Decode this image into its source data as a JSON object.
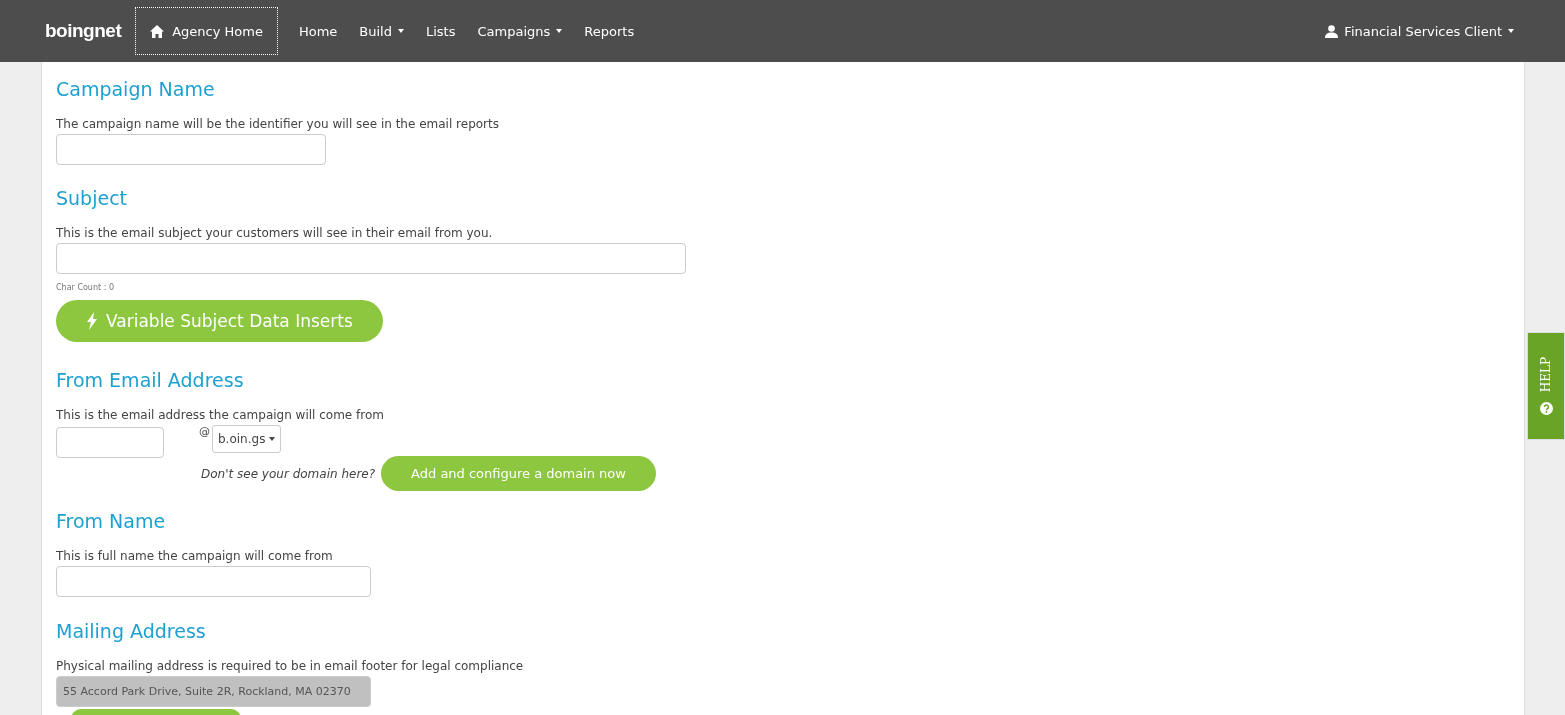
{
  "nav": {
    "logo": "boingnet",
    "agency_home": "Agency Home",
    "items": [
      {
        "label": "Home",
        "dropdown": false
      },
      {
        "label": "Build",
        "dropdown": true
      },
      {
        "label": "Lists",
        "dropdown": false
      },
      {
        "label": "Campaigns",
        "dropdown": true
      },
      {
        "label": "Reports",
        "dropdown": false
      }
    ],
    "user": "Financial Services Client"
  },
  "campaign_name": {
    "heading": "Campaign Name",
    "description": "The campaign name will be the identifier you will see in the email reports"
  },
  "subject": {
    "heading": "Subject",
    "description": "This is the email subject your customers will see in their email from you.",
    "char_count": "Char Count : 0",
    "inserts_button": "Variable Subject Data Inserts"
  },
  "from_email": {
    "heading": "From Email Address",
    "description": "This is the email address the campaign will come from",
    "at": "@",
    "domain": "b.oin.gs",
    "hint": "Don't see your domain here?",
    "add_domain_button": "Add and configure a domain now"
  },
  "from_name": {
    "heading": "From Name",
    "description": "This is full name the campaign will come from"
  },
  "mailing_address": {
    "heading": "Mailing Address",
    "description": "Physical mailing address is required to be in email footer for legal compliance",
    "value": "55 Accord Park Drive, Suite 2R, Rockland, MA 02370",
    "disabled": true
  },
  "help_tab": {
    "label": "HELP"
  }
}
